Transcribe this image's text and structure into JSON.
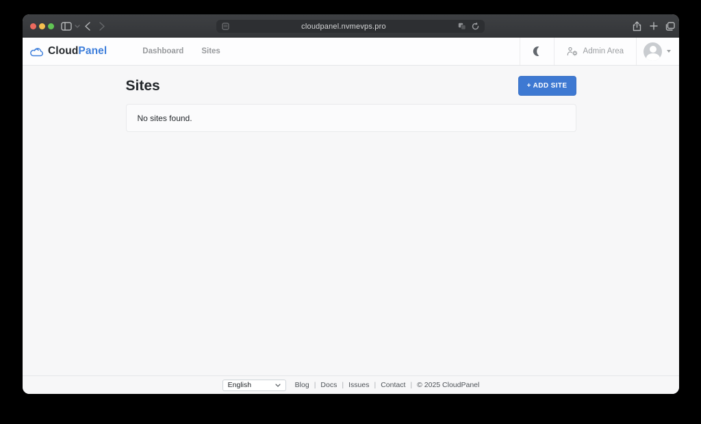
{
  "browser": {
    "url": "cloudpanel.nvmevps.pro"
  },
  "app_header": {
    "logo": {
      "cloud": "Cloud",
      "panel": "Panel"
    },
    "nav": [
      {
        "label": "Dashboard"
      },
      {
        "label": "Sites"
      }
    ],
    "admin_area": "Admin Area"
  },
  "page": {
    "title": "Sites",
    "add_site_button": "+ ADD SITE",
    "empty_state": "No sites found."
  },
  "footer": {
    "language": "English",
    "links": [
      {
        "label": "Blog"
      },
      {
        "label": "Docs"
      },
      {
        "label": "Issues"
      },
      {
        "label": "Contact"
      }
    ],
    "separator": "|",
    "copyright": "© 2025  CloudPanel"
  },
  "colors": {
    "accent_blue": "#3e79d2",
    "logo_blue": "#3d7edb",
    "traffic_red": "#ec6a5e",
    "traffic_yellow": "#f5bf4f",
    "traffic_green": "#61c554"
  },
  "icons": {
    "titlebar": [
      "sidebar-icon",
      "chevron-down-icon",
      "back-icon",
      "forward-icon",
      "reader-icon",
      "translate-icon",
      "reload-icon",
      "share-icon",
      "new-tab-icon",
      "tab-overview-icon"
    ],
    "header": [
      "cloud-logo-icon",
      "moon-icon",
      "users-gear-icon",
      "avatar",
      "caret-down-icon"
    ]
  }
}
